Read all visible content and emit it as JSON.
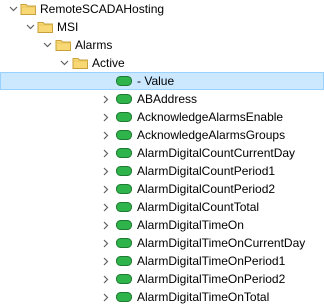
{
  "tree": {
    "nodes": [
      {
        "label": "RemoteSCADAHosting",
        "type": "folder",
        "expanded": true
      },
      {
        "label": "MSI",
        "type": "folder",
        "expanded": true
      },
      {
        "label": "Alarms",
        "type": "folder",
        "expanded": true
      },
      {
        "label": "Active",
        "type": "folder",
        "expanded": true
      },
      {
        "label": "- Value",
        "type": "tag",
        "expanded": false,
        "selected": true
      },
      {
        "label": "ABAddress",
        "type": "tag",
        "expanded": false
      },
      {
        "label": "AcknowledgeAlarmsEnable",
        "type": "tag",
        "expanded": false
      },
      {
        "label": "AcknowledgeAlarmsGroups",
        "type": "tag",
        "expanded": false
      },
      {
        "label": "AlarmDigitalCountCurrentDay",
        "type": "tag",
        "expanded": false
      },
      {
        "label": "AlarmDigitalCountPeriod1",
        "type": "tag",
        "expanded": false
      },
      {
        "label": "AlarmDigitalCountPeriod2",
        "type": "tag",
        "expanded": false
      },
      {
        "label": "AlarmDigitalCountTotal",
        "type": "tag",
        "expanded": false
      },
      {
        "label": "AlarmDigitalTimeOn",
        "type": "tag",
        "expanded": false
      },
      {
        "label": "AlarmDigitalTimeOnCurrentDay",
        "type": "tag",
        "expanded": false
      },
      {
        "label": "AlarmDigitalTimeOnPeriod1",
        "type": "tag",
        "expanded": false
      },
      {
        "label": "AlarmDigitalTimeOnPeriod2",
        "type": "tag",
        "expanded": false
      },
      {
        "label": "AlarmDigitalTimeOnTotal",
        "type": "tag",
        "expanded": false
      }
    ],
    "icons": {
      "folder": "folder-icon",
      "tag": "tag-icon",
      "caret_expanded": "chevron-down-icon",
      "caret_collapsed": "chevron-right-icon"
    },
    "colors": {
      "selection_bg": "#cce8ff",
      "selection_border": "#99d1ff",
      "folder_fill": "#f8d775",
      "folder_edge": "#c9a13a",
      "tag_fill": "#2fb34b",
      "tag_edge": "#1e7a32",
      "caret": "#606060"
    }
  }
}
